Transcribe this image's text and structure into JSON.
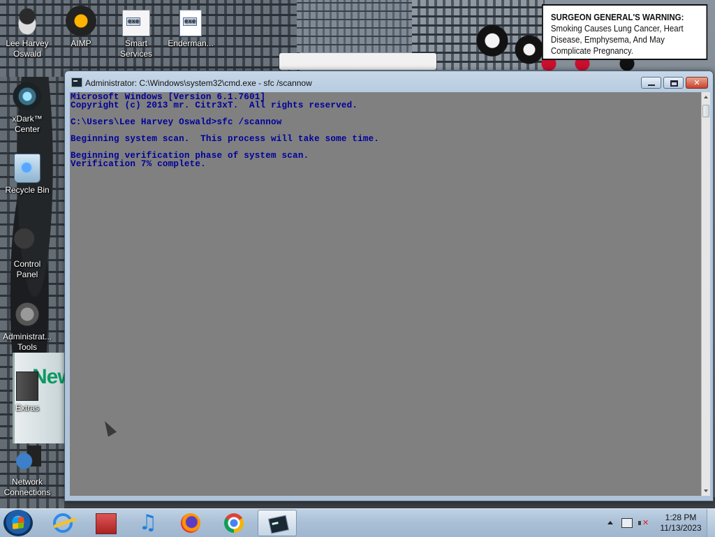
{
  "desktop": {
    "icons": [
      {
        "label": "Lee Harvey\nOswald",
        "line1": "Lee Harvey",
        "line2": "Oswald",
        "icon": "user-folder-icon"
      },
      {
        "label": "AIMP",
        "line1": "AIMP",
        "line2": "",
        "icon": "aimp-icon"
      },
      {
        "label": "Smart Services",
        "line1": "Smart",
        "line2": "Services",
        "icon": "exe-icon"
      },
      {
        "label": "Enderman...",
        "line1": "Enderman...",
        "line2": "",
        "icon": "exe-icon"
      },
      {
        "label": "xDark™ Center",
        "line1": "xDark™",
        "line2": "Center",
        "icon": "xdark-icon"
      },
      {
        "label": "Recycle Bin",
        "line1": "Recycle Bin",
        "line2": "",
        "icon": "recycle-bin-icon"
      },
      {
        "label": "Control Panel",
        "line1": "Control Panel",
        "line2": "",
        "icon": "control-panel-icon"
      },
      {
        "label": "Administrative Tools",
        "line1": "Administrat...",
        "line2": "Tools",
        "icon": "admin-tools-icon"
      },
      {
        "label": "Extras",
        "line1": "Extras",
        "line2": "",
        "icon": "extras-icon"
      },
      {
        "label": "Network Connections",
        "line1": "Network",
        "line2": "Connections",
        "icon": "network-icon"
      }
    ]
  },
  "wallpaper": {
    "warning_bold": "SURGEON GENERAL'S WARNING:",
    "warning_text": " Smoking Causes Lung Cancer, Heart Disease, Emphysema, And May Complicate Pregnancy.",
    "can_label": "New"
  },
  "window": {
    "title": "Administrator: C:\\Windows\\system32\\cmd.exe - sfc  /scannow",
    "minimize_label": "–",
    "maximize_label": "□",
    "close_label": "✕",
    "console_lines": [
      "Microsoft Windows [Version 6.1.7601]",
      "Copyright (c) 2013 mr. Citr3xT.  All rights reserved.",
      "",
      "C:\\Users\\Lee Harvey Oswald>sfc /scannow",
      "",
      "Beginning system scan.  This process will take some time.",
      "",
      "Beginning verification phase of system scan.",
      "Verification 7% complete."
    ],
    "console_text_color": "#00009a",
    "console_bg_color": "#808080"
  },
  "taskbar": {
    "pinned": [
      {
        "name": "internet-explorer",
        "icon": "internet-explorer-icon"
      },
      {
        "name": "media-center",
        "icon": "media-icon"
      },
      {
        "name": "music-player",
        "icon": "music-note-icon"
      },
      {
        "name": "firefox",
        "icon": "firefox-icon"
      },
      {
        "name": "chrome",
        "icon": "chrome-icon"
      },
      {
        "name": "cmd",
        "icon": "cmd-icon",
        "active": true
      }
    ],
    "clock": {
      "time": "1:28 PM",
      "date": "11/13/2023"
    }
  }
}
